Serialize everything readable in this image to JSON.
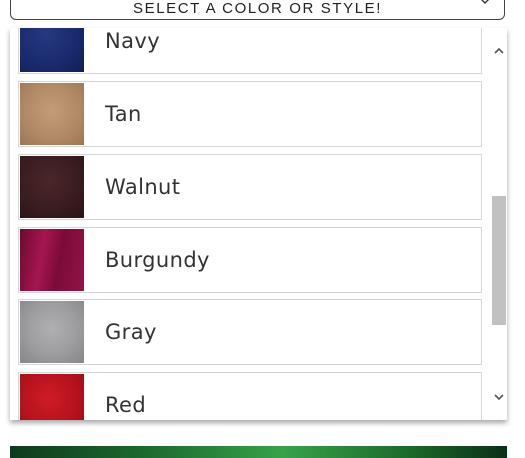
{
  "select": {
    "label": "SELECT A COLOR OR STYLE!",
    "icon": "chevron-down-icon"
  },
  "options": [
    {
      "label": "Navy",
      "color": "#1a2a6e"
    },
    {
      "label": "Tan",
      "color": "#b28a66"
    },
    {
      "label": "Walnut",
      "color": "#3a1d20"
    },
    {
      "label": "Burgundy",
      "color": "#8a0f3f"
    },
    {
      "label": "Gray",
      "color": "#9c9c9f"
    },
    {
      "label": "Red",
      "color": "#b5121d"
    }
  ],
  "scrollbar": {
    "up_icon": "chevron-up-icon",
    "down_icon": "chevron-down-icon"
  },
  "banner": {
    "accent": "#2f8c40"
  }
}
